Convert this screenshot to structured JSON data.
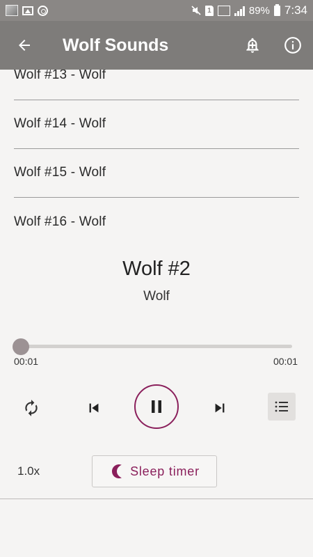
{
  "status_bar": {
    "battery": "89%",
    "time": "7:34",
    "sim": "1"
  },
  "app_bar": {
    "title": "Wolf Sounds",
    "back_icon": "arrow-left-icon",
    "alarm_icon": "alarm-add-icon",
    "info_icon": "info-icon"
  },
  "list": {
    "items": [
      {
        "label": "Wolf #13 - Wolf"
      },
      {
        "label": "Wolf #14 - Wolf"
      },
      {
        "label": "Wolf #15 - Wolf"
      },
      {
        "label": "Wolf #16 - Wolf"
      }
    ]
  },
  "player": {
    "title": "Wolf #2",
    "subtitle": "Wolf",
    "elapsed": "00:01",
    "duration": "00:01",
    "progress": 0,
    "speed": "1.0x",
    "sleep_timer_label": "Sleep timer",
    "accent_color": "#8a1f5b",
    "icons": {
      "repeat": "repeat-icon",
      "previous": "skip-previous-icon",
      "play_pause": "pause-icon",
      "next": "skip-next-icon",
      "queue": "queue-list-icon",
      "sleep": "moon-icon"
    }
  }
}
